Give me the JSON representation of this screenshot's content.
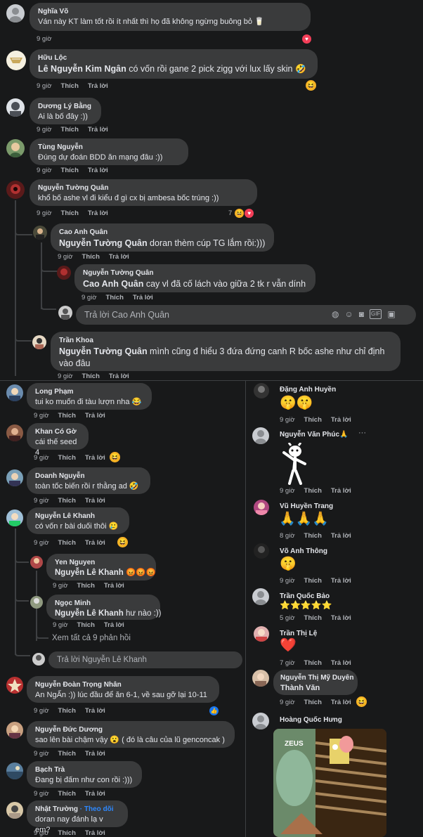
{
  "actions": {
    "time": "9 giờ",
    "like": "Thích",
    "reply": "Trả lời"
  },
  "c1": {
    "name": "Nghĩa Võ",
    "text": "Ván này KT làm tốt rồi ít nhất thì họ đã không ngừng buông bỏ 🥛"
  },
  "c2": {
    "name": "Hữu Lộc",
    "tag": "Lê Nguyễn Kim Ngân",
    "text": " có vốn rồi gane 2 pick zigg với lux lấy skin 🤣"
  },
  "c3": {
    "name": "Dương Lý Bằng",
    "text": "Ai là bố đây :))"
  },
  "c4": {
    "name": "Tùng Nguyễn",
    "text": "Đúng dự đoán BDD ăn mạng đâu :))"
  },
  "c5": {
    "name": "Nguyễn Tường Quân",
    "text": "khổ bố ashe vl đi kiểu đ gì cx bị ambesa bốc trúng :))",
    "react_count": "7"
  },
  "c5r1": {
    "name": "Cao Anh Quân",
    "tag": "Nguyễn Tường Quân",
    "text": " doran thèm cúp TG lắm rồi:)))"
  },
  "c5r2": {
    "name": "Nguyễn Tường Quân",
    "tag": "Cao Anh Quân",
    "text": " cay vl đã cố lách vào giữa 2 tk r vẫn dính"
  },
  "c5reply_input": "Trả lời Cao Anh Quân",
  "c6": {
    "name": "Trần Khoa",
    "tag": "Nguyễn Tường Quân",
    "text": " mình cũng đ hiểu 3 đứa đứng canh R bốc ashe như chỉ định vào đâu"
  },
  "left": [
    {
      "name": "Long Phạm",
      "text": "tui ko muốn đi tàu lượn nha 😂"
    },
    {
      "name": "Khan Có Gờ",
      "text": "cái thế seed 4"
    },
    {
      "name": "Doanh Nguyễn",
      "text": "toàn tốc biến rồi r thằng ad 🤣"
    },
    {
      "name": "Nguyễn Lê Khanh",
      "text": "có vốn r bài duối thôi 🥲"
    },
    {
      "name": "Nguyễn Đoàn Trọng Nhân",
      "text": "An NgẤn :)) lúc đầu để ăn 6-1, về sau gỡ lại 10-11"
    },
    {
      "name": "Nguyễn Đức Dương",
      "text": "sao lên bài chậm vậy 😮 ( đó là câu của lũ genconcak )"
    },
    {
      "name": "Bạch Trà",
      "text": "Đang bị đấm như con rồi :)))"
    },
    {
      "name": "Nhật Trường",
      "follow": "· Theo dõi",
      "text": "doran nay đánh lạ v em?"
    }
  ],
  "khanh_replies": [
    {
      "name": "Yen Nguyen",
      "tag": "Nguyễn Lê Khanh",
      "text": " 😡😡😡"
    },
    {
      "name": "Ngọc Minh",
      "tag": "Nguyễn Lê Khanh",
      "text": " hư nào :))"
    }
  ],
  "khanh_more": "Xem tất cả 9 phản hồi",
  "khanh_reply_input": "Trả lời Nguyễn Lê Khanh",
  "right": [
    {
      "name": "Đặng Anh Huyền",
      "content": "🤫🤫"
    },
    {
      "name": "Nguyễn Văn Phúc🙏",
      "more": "···"
    },
    {
      "name": "Vũ Huyền Trang",
      "content": "🙏🙏🙏"
    },
    {
      "name": "Võ Anh Thông",
      "content": "🤫"
    },
    {
      "name": "Trần Quốc Bảo",
      "content": "⭐⭐⭐⭐⭐",
      "time": "5 giờ"
    },
    {
      "name": "Trần Thị Lệ",
      "content": "❤️",
      "time": "7 giờ"
    },
    {
      "name": "Nguyễn Thị Mỹ Duyên",
      "content": "Thành Văn"
    },
    {
      "name": "Hoàng Quốc Hưng"
    }
  ],
  "right_times": {
    "t8": "8 giờ"
  },
  "meme_label": "ZEUS",
  "colors": {
    "bg": "#18191a",
    "bubble": "#3a3b3c",
    "meta": "#b0b3b8",
    "link": "#2d88ff",
    "heart": "#f33e58",
    "haha": "#f7b125",
    "like": "#1877f2"
  }
}
